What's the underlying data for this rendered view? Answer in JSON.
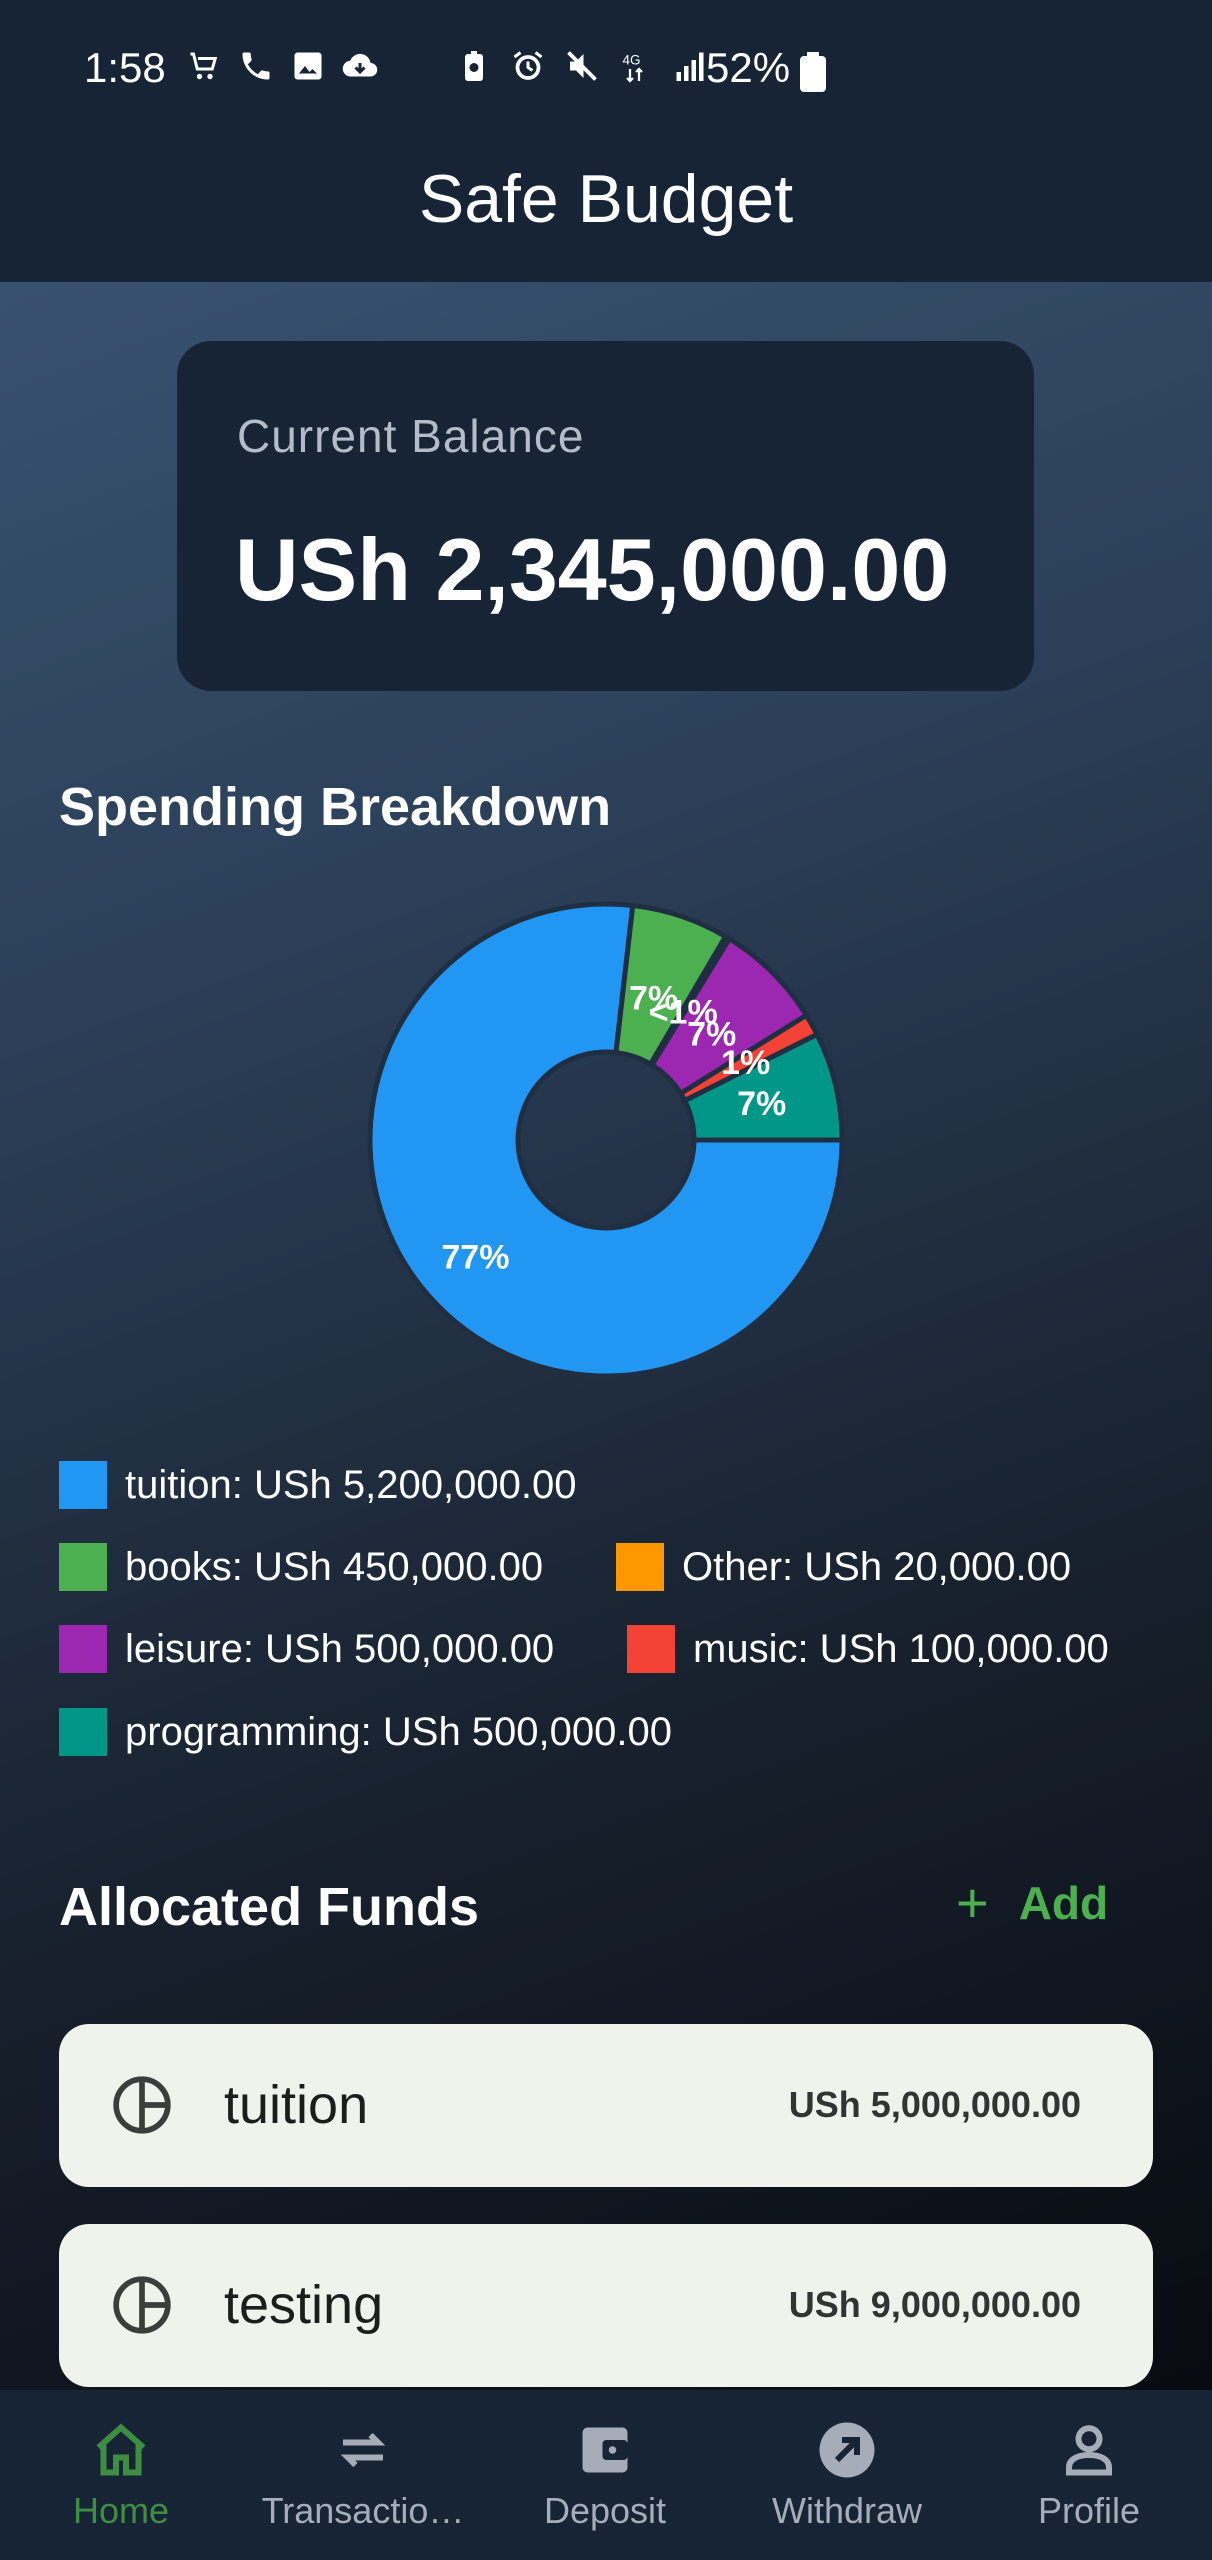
{
  "status_bar": {
    "time": "1:58",
    "battery_percent": "52%",
    "network": "4G"
  },
  "app_bar": {
    "title": "Safe Budget"
  },
  "balance": {
    "label": "Current Balance",
    "value": "USh 2,345,000.00"
  },
  "spending": {
    "title": "Spending Breakdown",
    "legend": [
      {
        "label": "tuition: USh 5,200,000.00",
        "color": "#2196f3"
      },
      {
        "label": "books: USh 450,000.00",
        "color": "#4caf50"
      },
      {
        "label": "Other: USh 20,000.00",
        "color": "#ff9800"
      },
      {
        "label": "leisure: USh 500,000.00",
        "color": "#9c27b0"
      },
      {
        "label": "music: USh 100,000.00",
        "color": "#f44336"
      },
      {
        "label": "programming: USh 500,000.00",
        "color": "#009688"
      }
    ]
  },
  "chart_data": {
    "type": "pie",
    "categories": [
      "tuition",
      "books",
      "Other",
      "leisure",
      "music",
      "programming"
    ],
    "values": [
      5200000,
      450000,
      20000,
      500000,
      100000,
      500000
    ],
    "labels": [
      "77%",
      "7%",
      "<1%",
      "7%",
      "1%",
      "7%"
    ],
    "colors": [
      "#2196f3",
      "#4caf50",
      "#ff9800",
      "#9c27b0",
      "#f44336",
      "#009688"
    ]
  },
  "allocated": {
    "title": "Allocated Funds",
    "add_label": "Add",
    "funds": [
      {
        "name": "tuition",
        "amount": "USh 5,000,000.00"
      },
      {
        "name": "testing",
        "amount": "USh 9,000,000.00"
      }
    ]
  },
  "bottom_nav": [
    {
      "label": "Home",
      "icon": "home-icon",
      "active": true
    },
    {
      "label": "Transactio…",
      "icon": "swap-arrows-icon",
      "active": false
    },
    {
      "label": "Deposit",
      "icon": "wallet-icon",
      "active": false
    },
    {
      "label": "Withdraw",
      "icon": "arrow-up-right-circle-icon",
      "active": false
    },
    {
      "label": "Profile",
      "icon": "person-icon",
      "active": false
    }
  ]
}
